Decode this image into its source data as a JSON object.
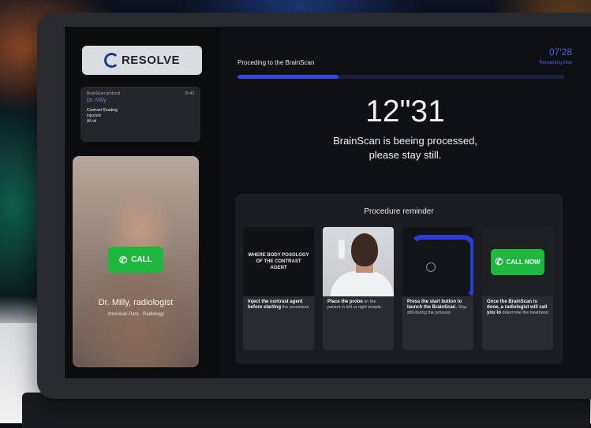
{
  "sidebar": {
    "logo_text": "RESOLVE",
    "notification": {
      "header": "BrainScan protocol",
      "time": "15:42",
      "title": "Dr. Milly",
      "body": "Contrast Reading\nInjected\nAll ok"
    },
    "video_call": {
      "call_label": "CALL",
      "name": "Dr. Milly, radiologist",
      "subtitle": "American Pare - Radiology"
    }
  },
  "main": {
    "step_label": "Proceding to the BrainScan",
    "remaining_time": "07'28",
    "remaining_label": "Remaining time",
    "progress_percent": 31,
    "countdown": "12\"31",
    "message_line1": "BrainScan is beeing processed,",
    "message_line2": "please stay still."
  },
  "reminder": {
    "title": "Procedure reminder",
    "cards": [
      {
        "image_text": "WHERE BODY POSOLOGY OF THE CONTRAST AGENT",
        "text_bold": "Inject the contrast agent before starting",
        "text": "the procedure"
      },
      {
        "text_bold": "Place the probe",
        "text": "on the patient in left or right temple."
      },
      {
        "text_bold": "Press the start button to launch the BrainScan.",
        "text": "Stay still during the process"
      },
      {
        "callnow_label": "CALL NOW",
        "text_bold": "Once the BrainScan is done, a radiologist will call you to",
        "text": "determine the treatment"
      }
    ]
  },
  "colors": {
    "accent_blue": "#2f4bdb",
    "call_green": "#1fb83f"
  }
}
